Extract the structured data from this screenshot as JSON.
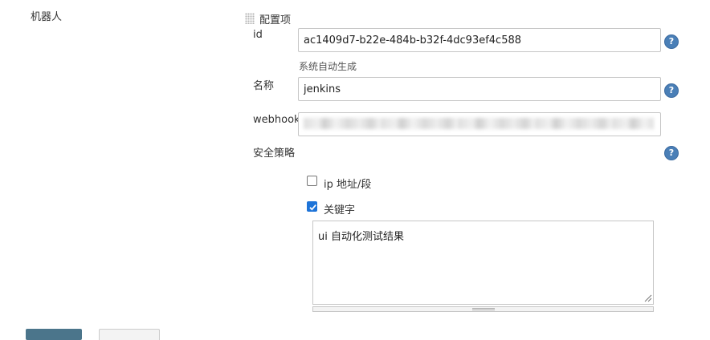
{
  "section": {
    "label": "机器人"
  },
  "config": {
    "title": "配置项"
  },
  "fields": {
    "id": {
      "label": "id",
      "value": "ac1409d7-b22e-484b-b32f-4dc93ef4c588",
      "hint": "系统自动生成"
    },
    "name": {
      "label": "名称",
      "value": "jenkins"
    },
    "webhook": {
      "label": "webhook"
    },
    "security": {
      "label": "安全策略",
      "options": [
        {
          "label": "ip 地址/段",
          "checked": false
        },
        {
          "label": "关键字",
          "checked": true
        }
      ],
      "keyword_value": "ui 自动化测试结果"
    }
  },
  "help": {
    "icon": "help-icon",
    "glyph": "?"
  },
  "colors": {
    "help": "#4a7fb7",
    "checkbox_checked": "#1e74d8",
    "primary_button": "#4b758b"
  }
}
